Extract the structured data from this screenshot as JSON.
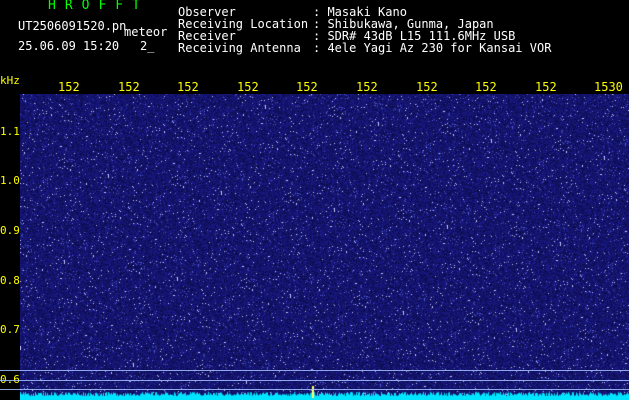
{
  "header": {
    "app_title": "HROFFT",
    "file_name": "UT2506091520.pn",
    "meteor_label": "meteor",
    "datetime": "25.06.09 15:20",
    "count": "2_",
    "meta": [
      {
        "key": "Observer",
        "value": ": Masaki Kano"
      },
      {
        "key": "Receiving Location",
        "value": ": Shibukawa, Gunma, Japan"
      },
      {
        "key": "Receiver",
        "value": ": SDR# 43dB L15 111.6MHz USB"
      },
      {
        "key": "Receiving Antenna",
        "value": ": 4ele Yagi Az 230 for Kansai VOR"
      }
    ]
  },
  "axis": {
    "unit": "kHz",
    "x_ticks": [
      "152",
      "152",
      "152",
      "152",
      "152",
      "152",
      "152",
      "152",
      "152",
      "1530"
    ],
    "y_ticks": [
      "1.1",
      "1.0",
      "0.9",
      "0.8",
      "0.7",
      "0.6"
    ]
  },
  "colors": {
    "background": "#000000",
    "noise": "#1a1a8c",
    "trace": "#00e5ff",
    "tick": "#ffff00",
    "title": "#00ff00"
  }
}
